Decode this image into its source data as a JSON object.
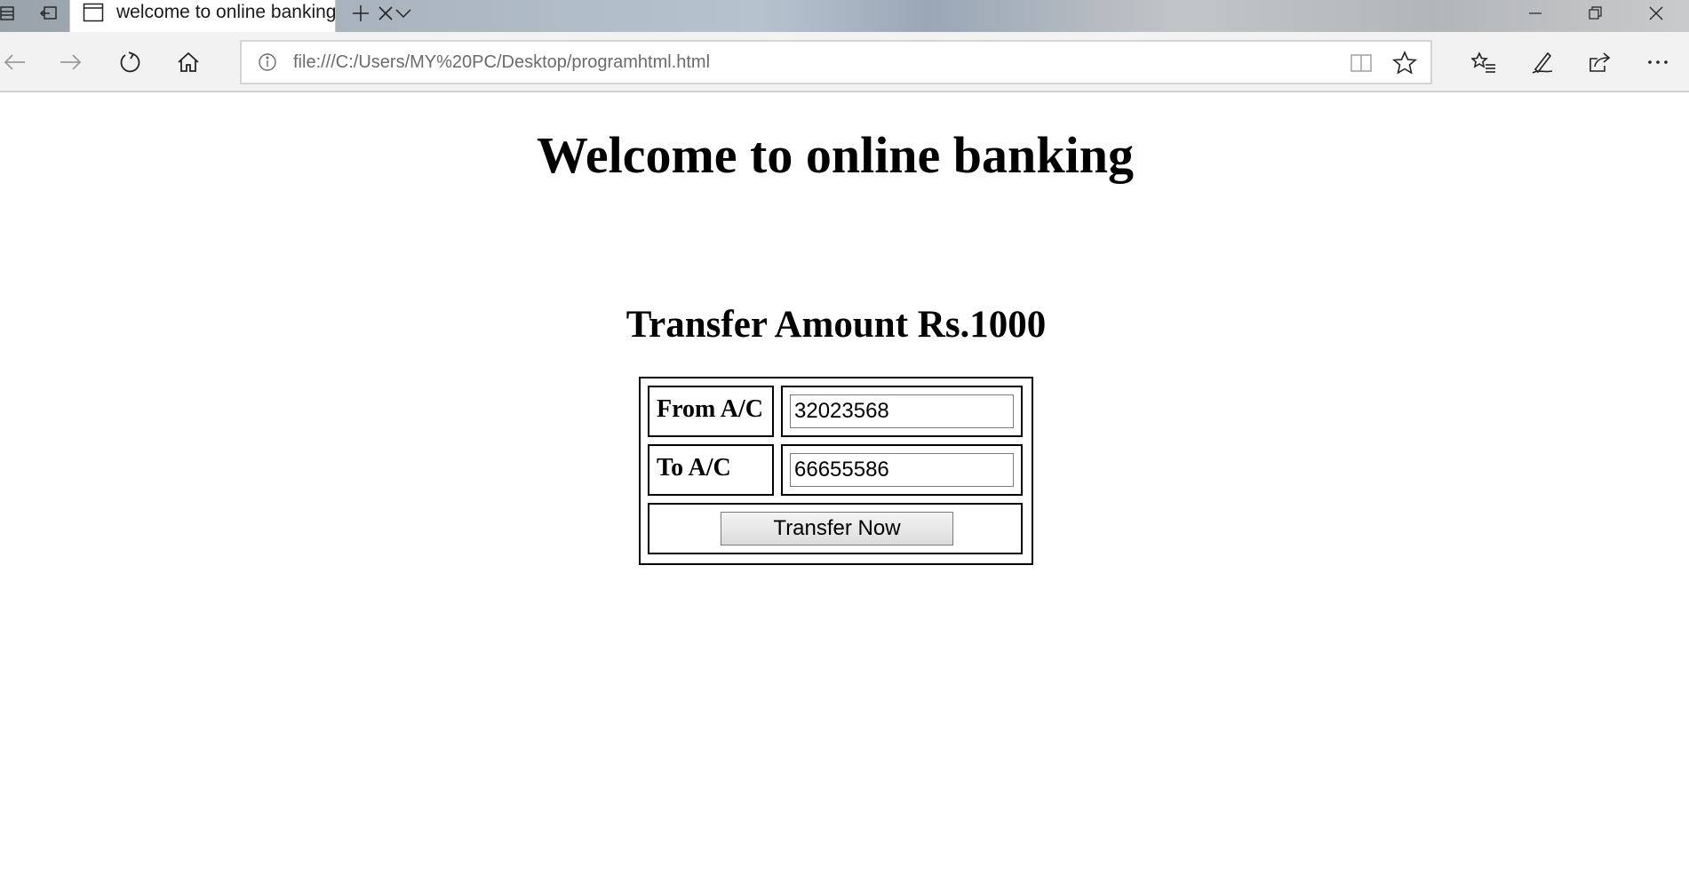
{
  "browser": {
    "tab": {
      "title": "welcome to online banking",
      "icons": [
        "tab-preview-icon",
        "tabs-aside-icon",
        "page-favicon-icon",
        "close-icon",
        "new-tab-icon",
        "tab-list-chevron-icon"
      ]
    },
    "window_controls": [
      "minimize-icon",
      "restore-icon",
      "close-icon"
    ],
    "nav": {
      "icons": [
        "back-arrow-icon",
        "forward-arrow-icon",
        "refresh-icon",
        "home-icon"
      ],
      "address": "file:///C:/Users/MY%20PC/Desktop/programhtml.html",
      "address_icons": [
        "info-icon",
        "reading-view-icon",
        "favorite-star-icon"
      ],
      "toolbar_icons": [
        "favorites-list-icon",
        "web-note-pen-icon",
        "share-icon",
        "more-dots-icon"
      ]
    }
  },
  "page": {
    "heading": "Welcome to online banking",
    "subheading": "Transfer Amount Rs.1000",
    "form": {
      "from_label": "From A/C",
      "from_value": "32023568",
      "to_label": "To A/C",
      "to_value": "66655586",
      "submit_label": "Transfer Now"
    }
  }
}
